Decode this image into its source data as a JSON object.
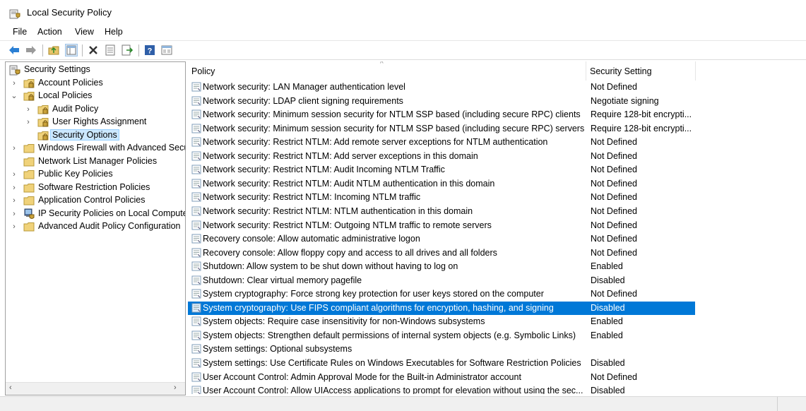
{
  "window": {
    "title": "Local Security Policy"
  },
  "menu": [
    "File",
    "Action",
    "View",
    "Help"
  ],
  "toolbar": {
    "icons": [
      "back-arrow-icon",
      "forward-arrow-icon",
      "up-folder-icon",
      "show-hide-tree-icon",
      "delete-icon",
      "properties-icon",
      "export-list-icon",
      "help-icon",
      "console-tree-icon"
    ]
  },
  "tree": {
    "items": [
      {
        "label": "Security Settings",
        "level": 0,
        "expander": "",
        "icon": "security-settings-icon"
      },
      {
        "label": "Account Policies",
        "level": 1,
        "expander": "›",
        "icon": "folder-lock-icon"
      },
      {
        "label": "Local Policies",
        "level": 1,
        "expander": "⌄",
        "icon": "folder-lock-icon"
      },
      {
        "label": "Audit Policy",
        "level": 2,
        "expander": "›",
        "icon": "folder-lock-icon"
      },
      {
        "label": "User Rights Assignment",
        "level": 2,
        "expander": "›",
        "icon": "folder-lock-icon"
      },
      {
        "label": "Security Options",
        "level": 2,
        "expander": "",
        "icon": "folder-lock-icon",
        "selected": true
      },
      {
        "label": "Windows Firewall with Advanced Secu",
        "level": 1,
        "expander": "›",
        "icon": "folder-icon"
      },
      {
        "label": "Network List Manager Policies",
        "level": 1,
        "expander": "",
        "icon": "folder-icon"
      },
      {
        "label": "Public Key Policies",
        "level": 1,
        "expander": "›",
        "icon": "folder-icon"
      },
      {
        "label": "Software Restriction Policies",
        "level": 1,
        "expander": "›",
        "icon": "folder-icon"
      },
      {
        "label": "Application Control Policies",
        "level": 1,
        "expander": "›",
        "icon": "folder-icon"
      },
      {
        "label": "IP Security Policies on Local Compute",
        "level": 1,
        "expander": "›",
        "icon": "ip-security-icon"
      },
      {
        "label": "Advanced Audit Policy Configuration",
        "level": 1,
        "expander": "›",
        "icon": "folder-icon"
      }
    ],
    "scroll_left": "‹",
    "scroll_right": "›"
  },
  "list": {
    "columns": [
      "Policy",
      "Security Setting"
    ],
    "rows": [
      {
        "policy": "Network security: LAN Manager authentication level",
        "setting": "Not Defined"
      },
      {
        "policy": "Network security: LDAP client signing requirements",
        "setting": "Negotiate signing"
      },
      {
        "policy": "Network security: Minimum session security for NTLM SSP based (including secure RPC) clients",
        "setting": "Require 128-bit encrypti..."
      },
      {
        "policy": "Network security: Minimum session security for NTLM SSP based (including secure RPC) servers",
        "setting": "Require 128-bit encrypti..."
      },
      {
        "policy": "Network security: Restrict NTLM: Add remote server exceptions for NTLM authentication",
        "setting": "Not Defined"
      },
      {
        "policy": "Network security: Restrict NTLM: Add server exceptions in this domain",
        "setting": "Not Defined"
      },
      {
        "policy": "Network security: Restrict NTLM: Audit Incoming NTLM Traffic",
        "setting": "Not Defined"
      },
      {
        "policy": "Network security: Restrict NTLM: Audit NTLM authentication in this domain",
        "setting": "Not Defined"
      },
      {
        "policy": "Network security: Restrict NTLM: Incoming NTLM traffic",
        "setting": "Not Defined"
      },
      {
        "policy": "Network security: Restrict NTLM: NTLM authentication in this domain",
        "setting": "Not Defined"
      },
      {
        "policy": "Network security: Restrict NTLM: Outgoing NTLM traffic to remote servers",
        "setting": "Not Defined"
      },
      {
        "policy": "Recovery console: Allow automatic administrative logon",
        "setting": "Not Defined"
      },
      {
        "policy": "Recovery console: Allow floppy copy and access to all drives and all folders",
        "setting": "Not Defined"
      },
      {
        "policy": "Shutdown: Allow system to be shut down without having to log on",
        "setting": "Enabled"
      },
      {
        "policy": "Shutdown: Clear virtual memory pagefile",
        "setting": "Disabled"
      },
      {
        "policy": "System cryptography: Force strong key protection for user keys stored on the computer",
        "setting": "Not Defined"
      },
      {
        "policy": "System cryptography: Use FIPS compliant algorithms for encryption, hashing, and signing",
        "setting": "Disabled",
        "selected": true
      },
      {
        "policy": "System objects: Require case insensitivity for non-Windows subsystems",
        "setting": "Enabled"
      },
      {
        "policy": "System objects: Strengthen default permissions of internal system objects (e.g. Symbolic Links)",
        "setting": "Enabled"
      },
      {
        "policy": "System settings: Optional subsystems",
        "setting": ""
      },
      {
        "policy": "System settings: Use Certificate Rules on Windows Executables for Software Restriction Policies",
        "setting": "Disabled"
      },
      {
        "policy": "User Account Control: Admin Approval Mode for the Built-in Administrator account",
        "setting": "Not Defined"
      },
      {
        "policy": "User Account Control: Allow UIAccess applications to prompt for elevation without using the sec...",
        "setting": "Disabled"
      }
    ]
  },
  "colors": {
    "selection": "#0078d7",
    "tree_selection": "#cce8ff",
    "folder": "#e8c46a"
  }
}
